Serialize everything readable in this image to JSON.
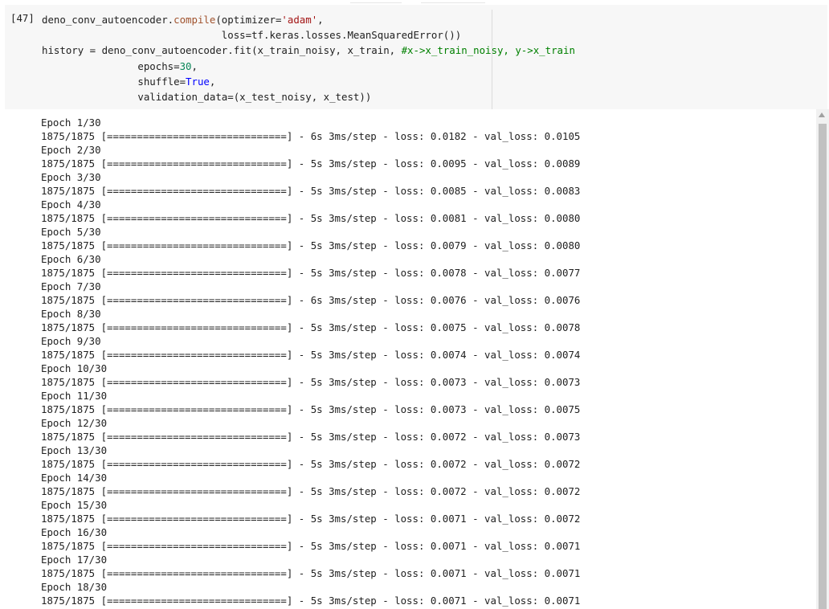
{
  "cell": {
    "exec_count": "[47]",
    "code_lines": [
      [
        {
          "t": "deno_conv_autoencoder.",
          "c": ""
        },
        {
          "t": "compile",
          "c": "kw-orange"
        },
        {
          "t": "(optimizer=",
          "c": ""
        },
        {
          "t": "'adam'",
          "c": "kw-str"
        },
        {
          "t": ",",
          "c": ""
        }
      ],
      [
        {
          "t": "                              loss=tf.keras.losses.MeanSquaredError())",
          "c": ""
        }
      ],
      [
        {
          "t": "history = deno_conv_autoencoder.fit(x_train_noisy, x_train, ",
          "c": ""
        },
        {
          "t": "#x->x_train_noisy, y->x_train",
          "c": "kw-comment"
        }
      ],
      [
        {
          "t": "                epochs=",
          "c": ""
        },
        {
          "t": "30",
          "c": "kw-num"
        },
        {
          "t": ",",
          "c": ""
        }
      ],
      [
        {
          "t": "                shuffle=",
          "c": ""
        },
        {
          "t": "True",
          "c": "kw-bool"
        },
        {
          "t": ",",
          "c": ""
        }
      ],
      [
        {
          "t": "                validation_data=(x_test_noisy, x_test))",
          "c": ""
        }
      ]
    ]
  },
  "output": {
    "lines": [
      "Epoch 1/30",
      "1875/1875 [==============================] - 6s 3ms/step - loss: 0.0182 - val_loss: 0.0105",
      "Epoch 2/30",
      "1875/1875 [==============================] - 5s 3ms/step - loss: 0.0095 - val_loss: 0.0089",
      "Epoch 3/30",
      "1875/1875 [==============================] - 5s 3ms/step - loss: 0.0085 - val_loss: 0.0083",
      "Epoch 4/30",
      "1875/1875 [==============================] - 5s 3ms/step - loss: 0.0081 - val_loss: 0.0080",
      "Epoch 5/30",
      "1875/1875 [==============================] - 5s 3ms/step - loss: 0.0079 - val_loss: 0.0080",
      "Epoch 6/30",
      "1875/1875 [==============================] - 5s 3ms/step - loss: 0.0078 - val_loss: 0.0077",
      "Epoch 7/30",
      "1875/1875 [==============================] - 6s 3ms/step - loss: 0.0076 - val_loss: 0.0076",
      "Epoch 8/30",
      "1875/1875 [==============================] - 5s 3ms/step - loss: 0.0075 - val_loss: 0.0078",
      "Epoch 9/30",
      "1875/1875 [==============================] - 5s 3ms/step - loss: 0.0074 - val_loss: 0.0074",
      "Epoch 10/30",
      "1875/1875 [==============================] - 5s 3ms/step - loss: 0.0073 - val_loss: 0.0073",
      "Epoch 11/30",
      "1875/1875 [==============================] - 5s 3ms/step - loss: 0.0073 - val_loss: 0.0075",
      "Epoch 12/30",
      "1875/1875 [==============================] - 5s 3ms/step - loss: 0.0072 - val_loss: 0.0073",
      "Epoch 13/30",
      "1875/1875 [==============================] - 5s 3ms/step - loss: 0.0072 - val_loss: 0.0072",
      "Epoch 14/30",
      "1875/1875 [==============================] - 5s 3ms/step - loss: 0.0072 - val_loss: 0.0072",
      "Epoch 15/30",
      "1875/1875 [==============================] - 5s 3ms/step - loss: 0.0071 - val_loss: 0.0072",
      "Epoch 16/30",
      "1875/1875 [==============================] - 5s 3ms/step - loss: 0.0071 - val_loss: 0.0071",
      "Epoch 17/30",
      "1875/1875 [==============================] - 5s 3ms/step - loss: 0.0071 - val_loss: 0.0071",
      "Epoch 18/30",
      "1875/1875 [==============================] - 5s 3ms/step - loss: 0.0071 - val_loss: 0.0071"
    ]
  }
}
